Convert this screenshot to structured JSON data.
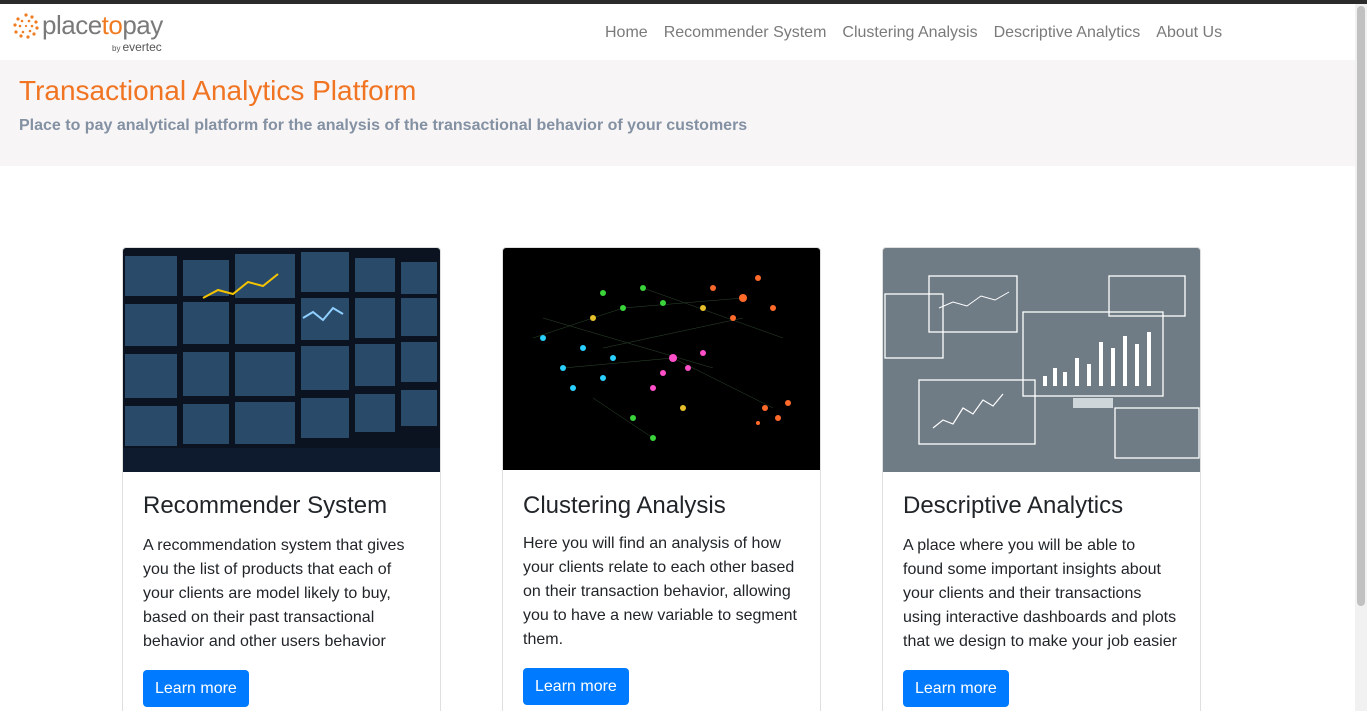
{
  "brand": {
    "word_a": "place",
    "word_b": "to",
    "word_c": "pay",
    "sub_by": "by",
    "sub_name": "evertec"
  },
  "nav": [
    "Home",
    "Recommender System",
    "Clustering Analysis",
    "Descriptive Analytics",
    "About Us"
  ],
  "hero": {
    "title": "Transactional Analytics Platform",
    "subtitle": "Place to pay analytical platform for the analysis of the transactional behavior of your customers"
  },
  "cards": [
    {
      "title": "Recommender System",
      "text": "A recommendation system that gives you the list of products that each of your clients are model likely to buy, based on their past transactional behavior and other users behavior",
      "button": "Learn more"
    },
    {
      "title": "Clustering Analysis",
      "text": "Here you will find an analysis of how your clients relate to each other based on their transaction behavior, allowing you to have a new variable to segment them.",
      "button": "Learn more"
    },
    {
      "title": "Descriptive Analytics",
      "text": "A place where you will be able to found some important insights about your clients and their transactions using interactive dashboards and plots that we design to make your job easier",
      "button": "Learn more"
    }
  ],
  "colors": {
    "accent": "#f07422",
    "primary": "#007bff",
    "subtitle": "#8391a3"
  }
}
